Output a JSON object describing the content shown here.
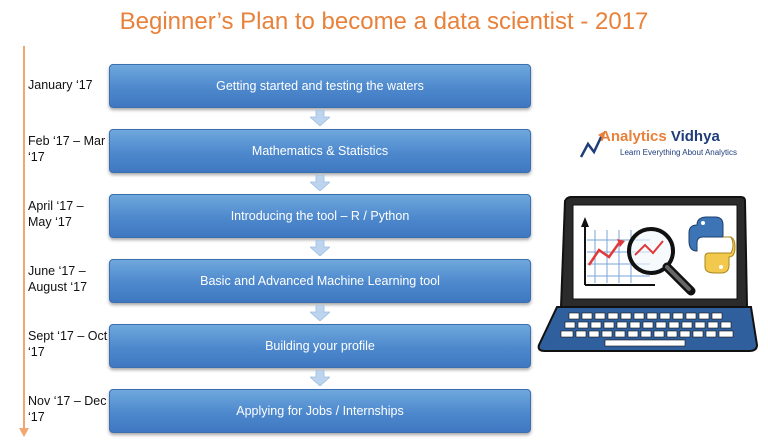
{
  "title": "Beginner’s Plan to become a data scientist - 2017",
  "steps": [
    {
      "date": "January ‘17",
      "label": "Getting started and testing the waters"
    },
    {
      "date": "Feb ‘17 – Mar ‘17",
      "label": "Mathematics & Statistics"
    },
    {
      "date": "April ‘17 – May ‘17",
      "label": "Introducing the tool – R / Python"
    },
    {
      "date": "June ‘17 – August ‘17",
      "label": "Basic and Advanced Machine Learning tool"
    },
    {
      "date": "Sept ‘17 – Oct ‘17",
      "label": "Building your profile"
    },
    {
      "date": "Nov ‘17 – Dec ‘17",
      "label": "Applying for Jobs / Internships"
    }
  ],
  "logo": {
    "name_accent": "Analytics",
    "name_rest": " Vidhya",
    "tagline": "Learn Everything About Analytics"
  },
  "colors": {
    "title": "#e8813a",
    "box": "#4d88cd",
    "timeline": "#f0a870",
    "arrow": "#bcd4ee"
  },
  "icons": [
    "timeline-arrow",
    "down-arrow-icon",
    "analytics-vidhya-logo",
    "laptop-illustration",
    "magnifier-icon",
    "python-icon"
  ]
}
